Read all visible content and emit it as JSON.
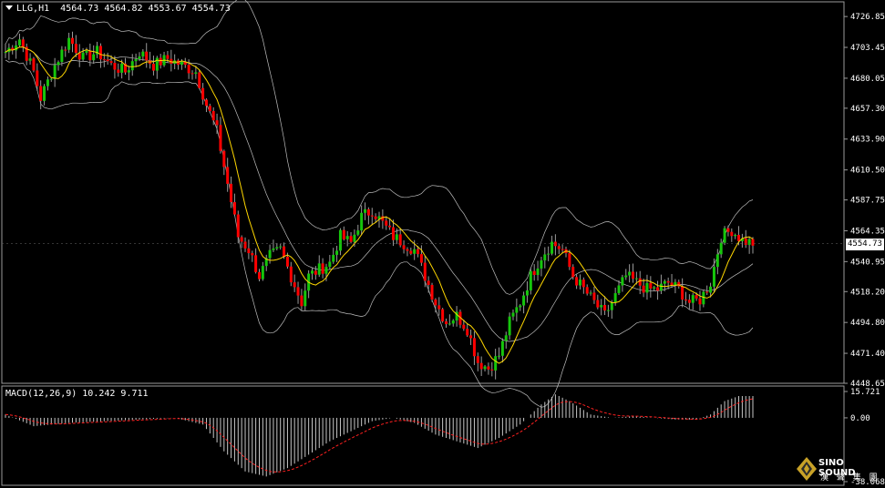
{
  "header": {
    "symbol": "LLG,H1",
    "ohlc": "4564.73 4564.82 4553.67 4554.73"
  },
  "macd_header": {
    "label": "MACD(12,26,9) 10.242 9.711"
  },
  "current_price": "4554.73",
  "logo": {
    "text": "SINO SOUND",
    "subtext": "漢 聲 集 團"
  },
  "colors": {
    "background": "#000000",
    "bull": "#16c60c",
    "bear": "#ff0000",
    "wick": "#9a9a9a",
    "ma": "#ffd700",
    "bands": "#bdbdbd",
    "macd_hist": "#c8c8c8",
    "macd_signal": "#ff2020",
    "frame": "#9a9a9a"
  },
  "chart_data": [
    {
      "type": "candlestick",
      "ylim": [
        4448.65,
        4738.0
      ],
      "y_ticks": [
        4726.85,
        4703.45,
        4680.05,
        4657.3,
        4633.9,
        4610.5,
        4587.75,
        4564.35,
        4540.95,
        4518.2,
        4494.8,
        4471.4,
        4448.65
      ],
      "anchors": [
        [
          0,
          4700
        ],
        [
          4,
          4710
        ],
        [
          8,
          4685
        ],
        [
          10,
          4665
        ],
        [
          14,
          4690
        ],
        [
          18,
          4710
        ],
        [
          22,
          4695
        ],
        [
          26,
          4700
        ],
        [
          30,
          4690
        ],
        [
          34,
          4685
        ],
        [
          38,
          4700
        ],
        [
          42,
          4690
        ],
        [
          46,
          4695
        ],
        [
          50,
          4690
        ],
        [
          54,
          4685
        ],
        [
          57,
          4660
        ],
        [
          60,
          4640
        ],
        [
          63,
          4600
        ],
        [
          66,
          4560
        ],
        [
          69,
          4550
        ],
        [
          72,
          4530
        ],
        [
          75,
          4545
        ],
        [
          78,
          4550
        ],
        [
          81,
          4530
        ],
        [
          84,
          4510
        ],
        [
          86,
          4530
        ],
        [
          89,
          4535
        ],
        [
          92,
          4540
        ],
        [
          95,
          4560
        ],
        [
          98,
          4555
        ],
        [
          101,
          4575
        ],
        [
          104,
          4580
        ],
        [
          107,
          4570
        ],
        [
          110,
          4560
        ],
        [
          113,
          4555
        ],
        [
          116,
          4550
        ],
        [
          119,
          4530
        ],
        [
          122,
          4510
        ],
        [
          125,
          4495
        ],
        [
          128,
          4500
        ],
        [
          131,
          4490
        ],
        [
          134,
          4465
        ],
        [
          137,
          4460
        ],
        [
          140,
          4470
        ],
        [
          143,
          4495
        ],
        [
          146,
          4510
        ],
        [
          149,
          4530
        ],
        [
          152,
          4545
        ],
        [
          155,
          4555
        ],
        [
          158,
          4550
        ],
        [
          161,
          4530
        ],
        [
          164,
          4520
        ],
        [
          167,
          4510
        ],
        [
          170,
          4500
        ],
        [
          173,
          4515
        ],
        [
          176,
          4530
        ],
        [
          179,
          4525
        ],
        [
          182,
          4520
        ],
        [
          185,
          4520
        ],
        [
          188,
          4525
        ],
        [
          191,
          4520
        ],
        [
          194,
          4510
        ],
        [
          197,
          4512
        ],
        [
          200,
          4525
        ],
        [
          203,
          4560
        ],
        [
          206,
          4565
        ],
        [
          209,
          4557
        ],
        [
          212,
          4555
        ]
      ],
      "moving_average": "yellow",
      "bollinger_bands": true
    },
    {
      "type": "bar",
      "name": "MACD(12,26,9)",
      "y_ticks": [
        15.721,
        0.0,
        -38.068
      ],
      "ylim": [
        -38.068,
        15.721
      ],
      "histogram_anchors": [
        [
          0,
          2
        ],
        [
          8,
          -5
        ],
        [
          18,
          -3
        ],
        [
          28,
          -2
        ],
        [
          38,
          -1
        ],
        [
          48,
          0
        ],
        [
          56,
          -4
        ],
        [
          62,
          -20
        ],
        [
          68,
          -32
        ],
        [
          74,
          -35
        ],
        [
          80,
          -30
        ],
        [
          86,
          -22
        ],
        [
          92,
          -14
        ],
        [
          98,
          -8
        ],
        [
          104,
          -2
        ],
        [
          110,
          0
        ],
        [
          116,
          -3
        ],
        [
          122,
          -10
        ],
        [
          128,
          -14
        ],
        [
          134,
          -18
        ],
        [
          140,
          -12
        ],
        [
          146,
          -4
        ],
        [
          152,
          8
        ],
        [
          156,
          14
        ],
        [
          160,
          10
        ],
        [
          166,
          2
        ],
        [
          172,
          0
        ],
        [
          178,
          1
        ],
        [
          184,
          0
        ],
        [
          190,
          -1
        ],
        [
          196,
          -1
        ],
        [
          200,
          2
        ],
        [
          204,
          10
        ],
        [
          208,
          13
        ],
        [
          212,
          13
        ]
      ]
    }
  ]
}
